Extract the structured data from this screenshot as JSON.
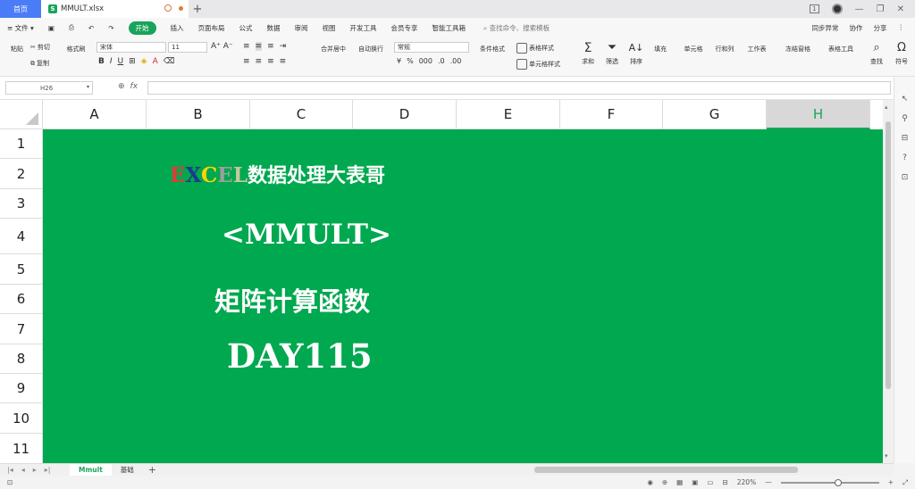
{
  "titlebar": {
    "home_tab": "首页",
    "doc_tab": "MMULT.xlsx",
    "doc_icon": "S",
    "new_tab": "+",
    "badge": "1"
  },
  "menubar": {
    "file": "≡ 文件 ▾",
    "tabs": [
      "开始",
      "插入",
      "页面布局",
      "公式",
      "数据",
      "审阅",
      "视图",
      "开发工具",
      "会员专享",
      "智能工具箱"
    ],
    "search": "查找命令、搜索模板",
    "sync": "同步异常",
    "collab": "协作",
    "share": "分享"
  },
  "ribbon": {
    "clipboard": {
      "cut": "剪切",
      "paste": "粘贴",
      "copy": "复制",
      "format_painter": "格式刷"
    },
    "font": {
      "name": "宋体",
      "size": "11"
    },
    "number_format": "常规",
    "buttons": [
      "合并居中",
      "自动换行",
      "条件格式",
      "表格样式",
      "单元格样式",
      "求和",
      "筛选",
      "排序",
      "填充",
      "单元格",
      "行和列",
      "工作表",
      "冻结窗格",
      "表格工具",
      "查找",
      "符号"
    ]
  },
  "formulabar": {
    "cell_ref": "H26",
    "fx": "fx",
    "value": ""
  },
  "grid": {
    "columns": [
      "A",
      "B",
      "C",
      "D",
      "E",
      "F",
      "G",
      "H"
    ],
    "selected_column": "H",
    "rows": [
      "1",
      "2",
      "3",
      "4",
      "5",
      "6",
      "7",
      "8",
      "9",
      "10",
      "11"
    ],
    "fill_color": "#00a84f",
    "content": {
      "brand_letters": [
        {
          "ch": "E",
          "color": "#e53935"
        },
        {
          "ch": "X",
          "color": "#1e3a8a"
        },
        {
          "ch": "C",
          "color": "#ffd400"
        },
        {
          "ch": "E",
          "color": "#9e9e9e"
        },
        {
          "ch": "L",
          "color": "#c7c7a0"
        }
      ],
      "brand_rest": "数据处理大表哥",
      "function_title": "<MMULT>",
      "function_desc": "矩阵计算函数",
      "day": "DAY115"
    }
  },
  "sheets": {
    "tabs": [
      "Mmult",
      "基础"
    ],
    "active": "Mmult",
    "add": "+"
  },
  "statusbar": {
    "zoom": "220%",
    "minus": "—",
    "plus": "+"
  }
}
